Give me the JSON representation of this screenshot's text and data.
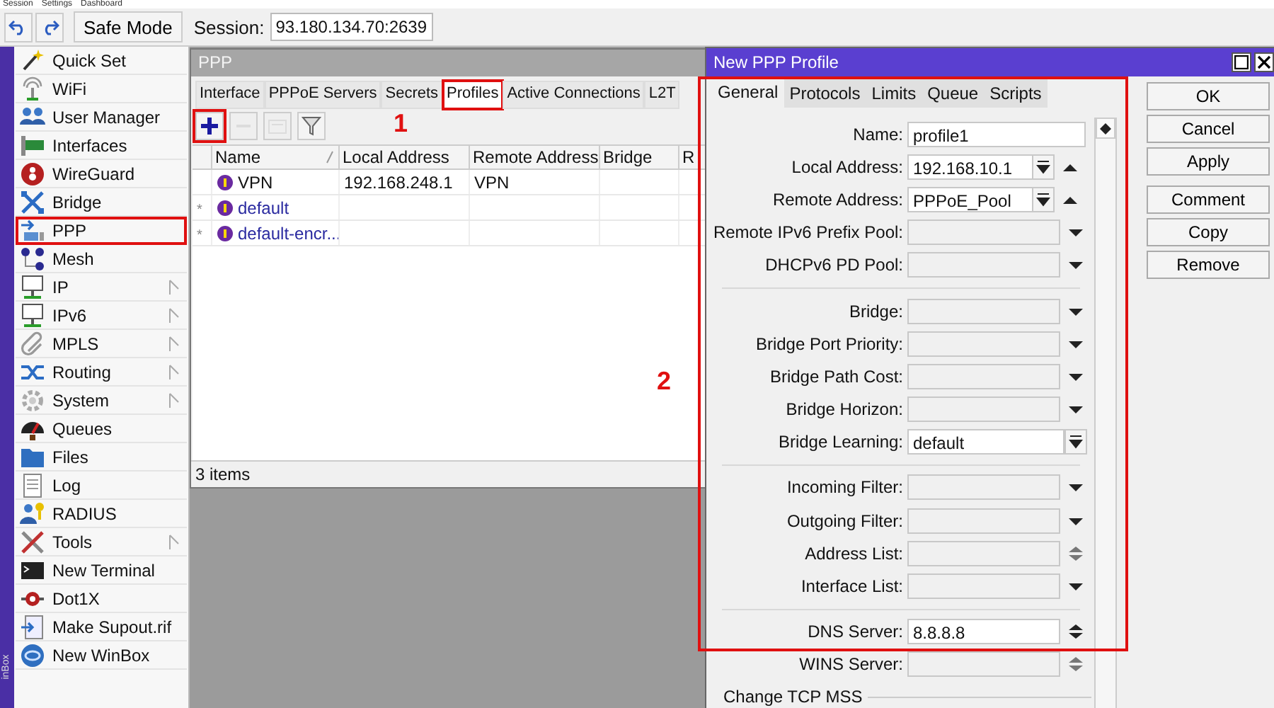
{
  "menu_bar": [
    "Session",
    "Settings",
    "Dashboard"
  ],
  "toolbar": {
    "safe_mode": "Safe Mode",
    "session_label": "Session:",
    "session_value": "93.180.134.70:2639"
  },
  "side_strip": "inBox",
  "sidebar": [
    {
      "label": "Quick Set",
      "kind": "wand",
      "submenu": false,
      "highlighted": false
    },
    {
      "label": "WiFi",
      "kind": "antenna",
      "submenu": false,
      "highlighted": false
    },
    {
      "label": "User Manager",
      "kind": "users",
      "submenu": false,
      "highlighted": false
    },
    {
      "label": "Interfaces",
      "kind": "card",
      "submenu": false,
      "highlighted": false
    },
    {
      "label": "WireGuard",
      "kind": "emblem",
      "submenu": false,
      "highlighted": false
    },
    {
      "label": "Bridge",
      "kind": "bridge",
      "submenu": false,
      "highlighted": false
    },
    {
      "label": "PPP",
      "kind": "ppp",
      "submenu": false,
      "highlighted": true
    },
    {
      "label": "Mesh",
      "kind": "mesh",
      "submenu": false,
      "highlighted": false
    },
    {
      "label": "IP",
      "kind": "monitor",
      "submenu": true,
      "highlighted": false
    },
    {
      "label": "IPv6",
      "kind": "monitor",
      "submenu": true,
      "highlighted": false
    },
    {
      "label": "MPLS",
      "kind": "paperclip",
      "submenu": true,
      "highlighted": false
    },
    {
      "label": "Routing",
      "kind": "shuffle",
      "submenu": true,
      "highlighted": false
    },
    {
      "label": "System",
      "kind": "gear",
      "submenu": true,
      "highlighted": false
    },
    {
      "label": "Queues",
      "kind": "gauge",
      "submenu": false,
      "highlighted": false
    },
    {
      "label": "Files",
      "kind": "folder",
      "submenu": false,
      "highlighted": false
    },
    {
      "label": "Log",
      "kind": "document",
      "submenu": false,
      "highlighted": false
    },
    {
      "label": "RADIUS",
      "kind": "userkey",
      "submenu": false,
      "highlighted": false
    },
    {
      "label": "Tools",
      "kind": "tools",
      "submenu": true,
      "highlighted": false
    },
    {
      "label": "New Terminal",
      "kind": "terminal",
      "submenu": false,
      "highlighted": false
    },
    {
      "label": "Dot1X",
      "kind": "plug",
      "submenu": false,
      "highlighted": false
    },
    {
      "label": "Make Supout.rif",
      "kind": "docarrow",
      "submenu": false,
      "highlighted": false
    },
    {
      "label": "New WinBox",
      "kind": "globe",
      "submenu": false,
      "highlighted": false
    }
  ],
  "ppp_window": {
    "title": "PPP",
    "annotation": "1",
    "tabs": [
      {
        "label": "Interface",
        "selected": false,
        "highlighted": false
      },
      {
        "label": "PPPoE Servers",
        "selected": false,
        "highlighted": false
      },
      {
        "label": "Secrets",
        "selected": false,
        "highlighted": false
      },
      {
        "label": "Profiles",
        "selected": true,
        "highlighted": true
      },
      {
        "label": "Active Connections",
        "selected": false,
        "highlighted": false
      },
      {
        "label": "L2T",
        "selected": false,
        "highlighted": false
      }
    ],
    "tools": [
      {
        "kind": "add",
        "disabled": false,
        "highlighted": true
      },
      {
        "kind": "remove",
        "disabled": true,
        "highlighted": false
      },
      {
        "kind": "note",
        "disabled": true,
        "highlighted": false
      },
      {
        "kind": "filter",
        "disabled": false,
        "highlighted": false
      }
    ],
    "columns": [
      "Name",
      "Local Address",
      "Remote Address",
      "Bridge",
      "R"
    ],
    "rows": [
      {
        "name": "VPN",
        "local_address": "192.168.248.1",
        "remote_address": "VPN",
        "default": false
      },
      {
        "flag": "*",
        "name": "default",
        "default": true
      },
      {
        "flag": "*",
        "name": "default-encr...",
        "default": true
      }
    ],
    "status": "3 items"
  },
  "dialog": {
    "title": "New PPP Profile",
    "annotation": "2",
    "highlighted": true,
    "tabs": [
      {
        "label": "General",
        "selected": true
      },
      {
        "label": "Protocols",
        "selected": false
      },
      {
        "label": "Limits",
        "selected": false
      },
      {
        "label": "Queue",
        "selected": false
      },
      {
        "label": "Scripts",
        "selected": false
      }
    ],
    "fields": [
      {
        "kind": "text",
        "label": "Name:",
        "value": "profile1"
      },
      {
        "kind": "combo",
        "label": "Local Address:",
        "value": "192.168.10.1"
      },
      {
        "kind": "combo",
        "label": "Remote Address:",
        "value": "PPPoE_Pool"
      },
      {
        "kind": "dropdown",
        "label": "Remote IPv6 Prefix Pool:"
      },
      {
        "kind": "dropdown",
        "label": "DHCPv6 PD Pool:"
      },
      {
        "kind": "separator"
      },
      {
        "kind": "dropdown",
        "label": "Bridge:"
      },
      {
        "kind": "dropdown",
        "label": "Bridge Port Priority:"
      },
      {
        "kind": "dropdown",
        "label": "Bridge Path Cost:"
      },
      {
        "kind": "dropdown",
        "label": "Bridge Horizon:"
      },
      {
        "kind": "select",
        "label": "Bridge Learning:",
        "value": "default"
      },
      {
        "kind": "separator"
      },
      {
        "kind": "dropdown",
        "label": "Incoming Filter:"
      },
      {
        "kind": "dropdown",
        "label": "Outgoing Filter:"
      },
      {
        "kind": "updown",
        "label": "Address List:"
      },
      {
        "kind": "dropdown",
        "label": "Interface List:"
      },
      {
        "kind": "separator"
      },
      {
        "kind": "updown",
        "label": "DNS Server:",
        "value": "8.8.8.8"
      },
      {
        "kind": "updown",
        "label": "WINS Server:"
      },
      {
        "kind": "section",
        "label": "Change TCP MSS"
      }
    ],
    "buttons": [
      "OK",
      "Cancel",
      "Apply",
      "Comment",
      "Copy",
      "Remove"
    ]
  }
}
